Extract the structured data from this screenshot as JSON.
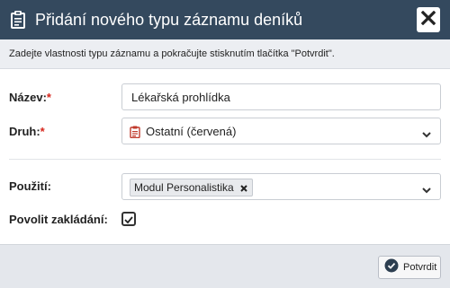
{
  "dialog": {
    "title": "Přidání nového typu záznamu deníků",
    "title_icon": "clipboard-icon",
    "close_icon": "close-icon"
  },
  "instructions": "Zadejte vlastnosti typu záznamu a pokračujte stisknutím tlačítka \"Potvrdit\".",
  "form": {
    "name": {
      "label": "Název:",
      "required_mark": "*",
      "value": "Lékařská prohlídka"
    },
    "kind": {
      "label": "Druh:",
      "required_mark": "*",
      "value": "Ostatní (červená)",
      "icon": "clipboard-icon",
      "icon_color": "#c0392b"
    },
    "usage": {
      "label": "Použití:",
      "tags": [
        "Modul Personalistika"
      ]
    },
    "allow_creation": {
      "label": "Povolit zakládání:",
      "checked": true
    }
  },
  "footer": {
    "confirm_label": "Potvrdit",
    "confirm_icon": "check-circle-icon"
  },
  "colors": {
    "titlebar": "#34495e",
    "required": "#d6261c"
  }
}
